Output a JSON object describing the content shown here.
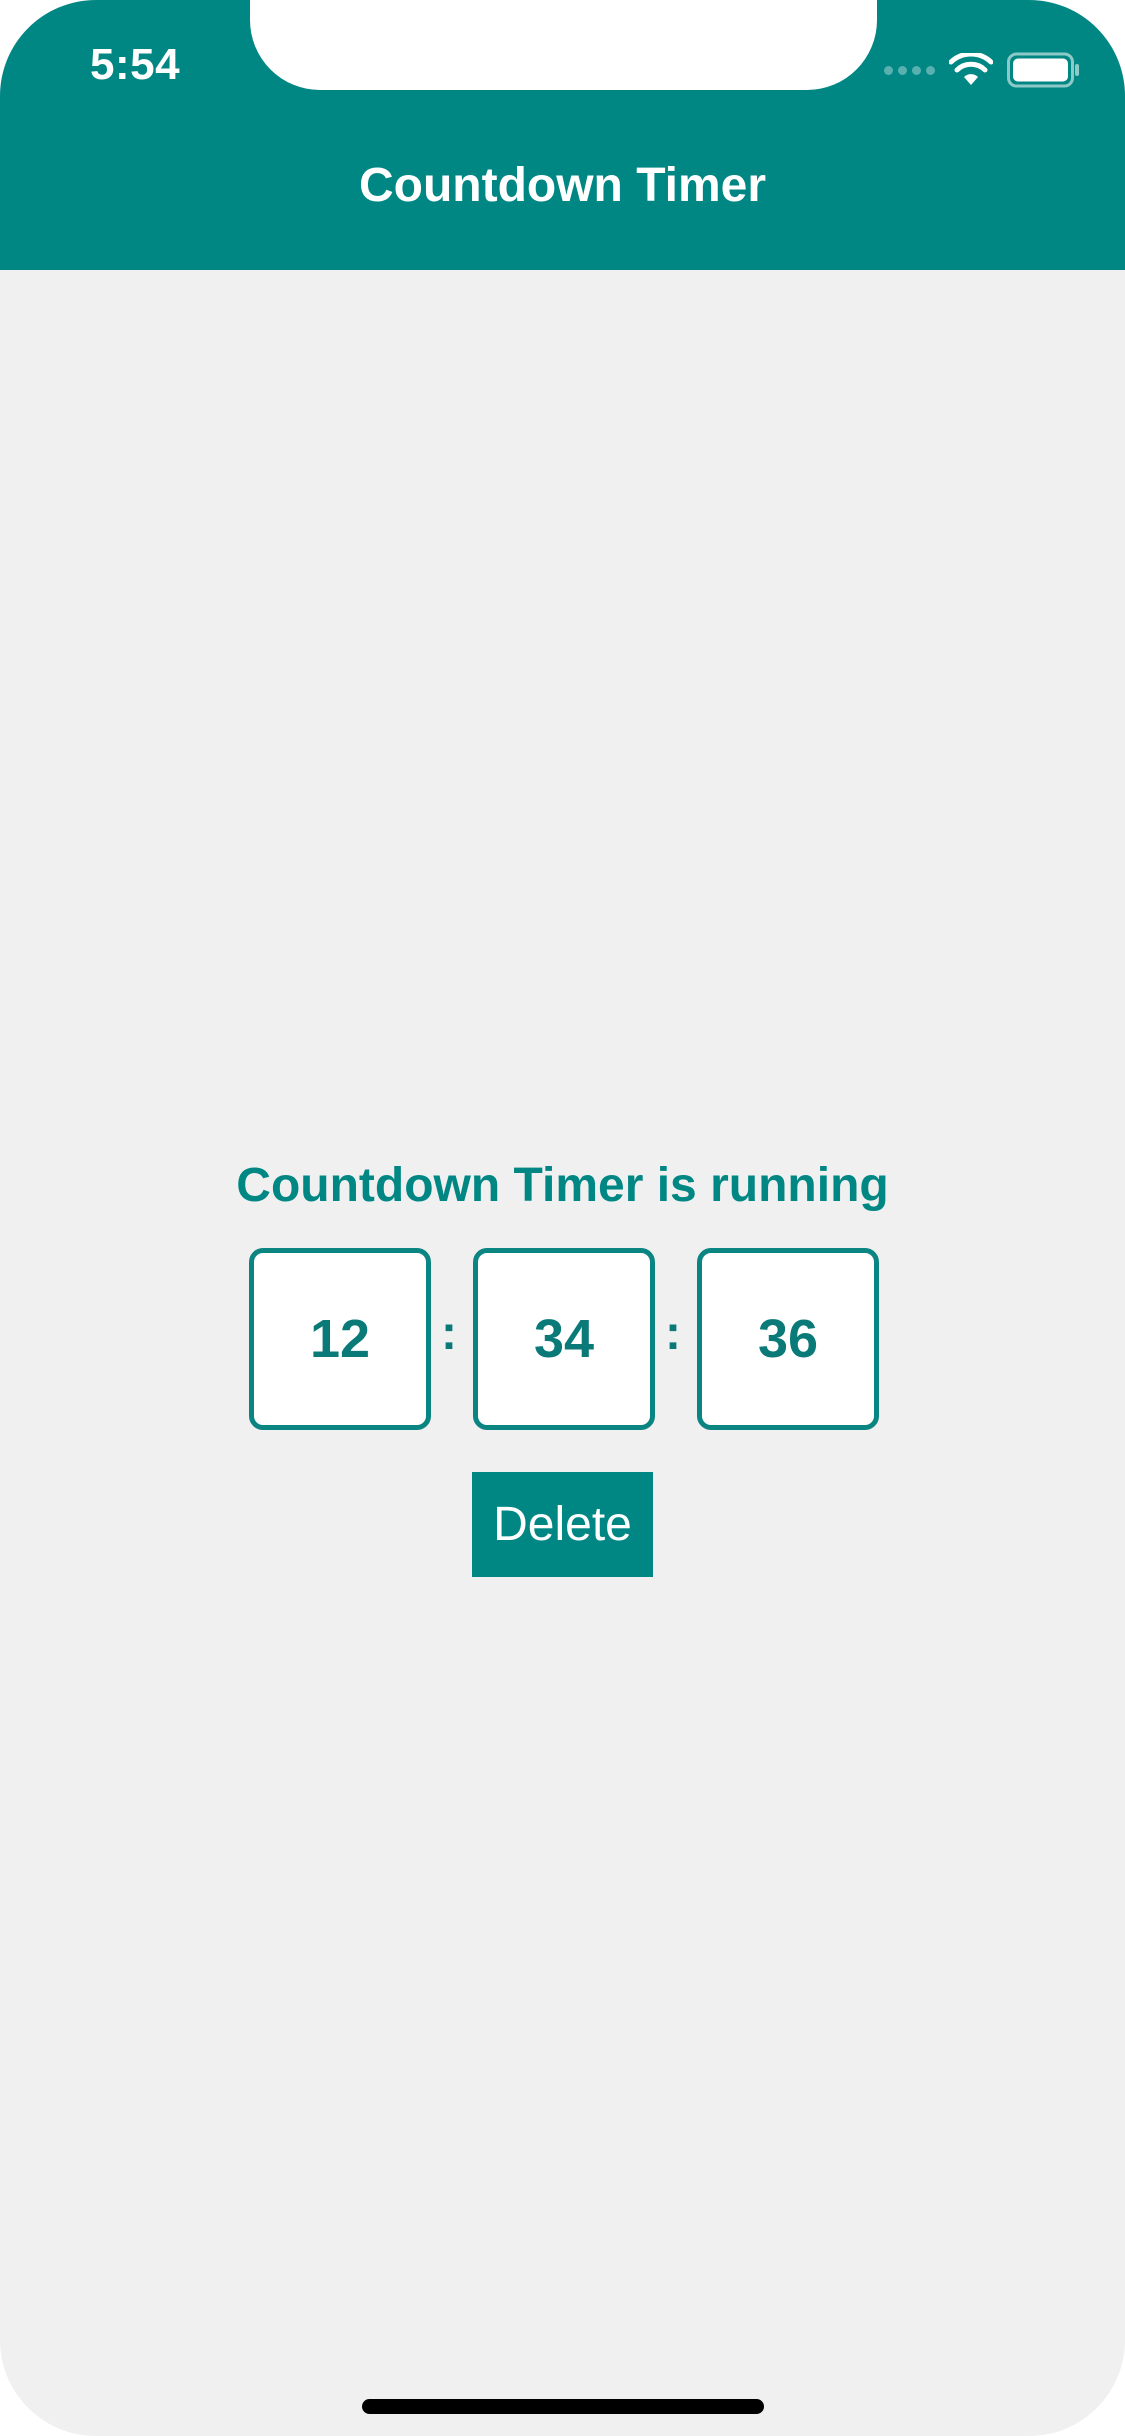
{
  "status_bar": {
    "time": "5:54",
    "wifi_icon": "wifi-icon",
    "battery_icon": "battery-icon",
    "signal_icon": "cellular-signal-icon"
  },
  "header": {
    "title": "Countdown Timer"
  },
  "timer": {
    "status_label": "Countdown Timer is running",
    "hours": "12",
    "minutes": "34",
    "seconds": "36",
    "separator": ":"
  },
  "actions": {
    "delete_label": "Delete"
  },
  "colors": {
    "accent": "#008784",
    "background": "#f0f0f0",
    "box_background": "#ffffff"
  }
}
